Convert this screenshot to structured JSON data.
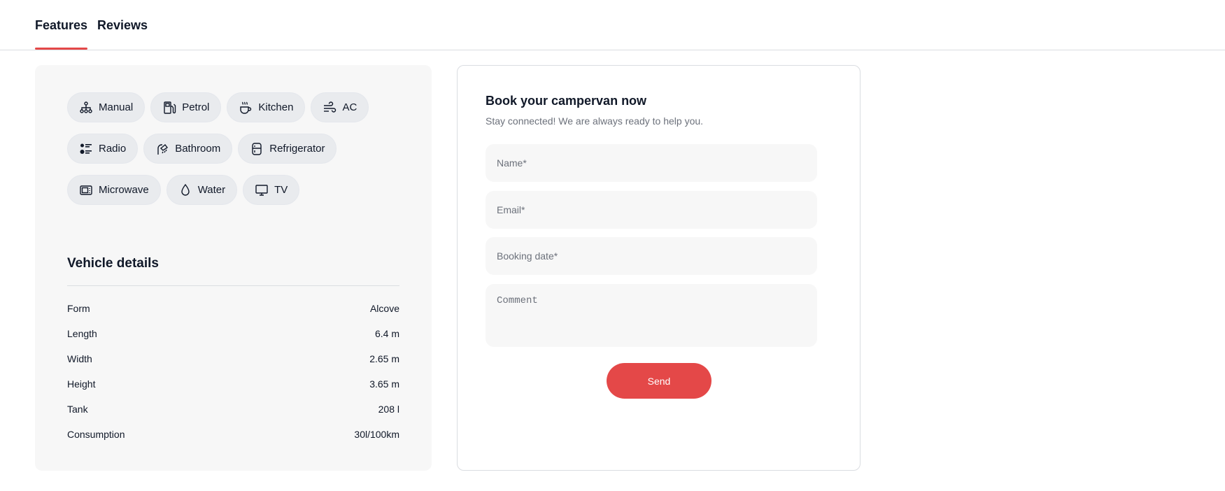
{
  "tabs": [
    {
      "label": "Features",
      "active": true
    },
    {
      "label": "Reviews",
      "active": false
    }
  ],
  "accent_color": "#e44848",
  "features": [
    {
      "label": "Manual",
      "icon": "transmission-icon"
    },
    {
      "label": "Petrol",
      "icon": "fuel-pump-icon"
    },
    {
      "label": "Kitchen",
      "icon": "cup-hot-icon"
    },
    {
      "label": "AC",
      "icon": "wind-icon"
    },
    {
      "label": "Radio",
      "icon": "radio-icon"
    },
    {
      "label": "Bathroom",
      "icon": "shower-icon"
    },
    {
      "label": "Refrigerator",
      "icon": "fridge-icon"
    },
    {
      "label": "Microwave",
      "icon": "microwave-icon"
    },
    {
      "label": "Water",
      "icon": "water-drop-icon"
    },
    {
      "label": "TV",
      "icon": "tv-icon"
    }
  ],
  "vehicle_details": {
    "title": "Vehicle details",
    "rows": [
      {
        "label": "Form",
        "value": "Alcove"
      },
      {
        "label": "Length",
        "value": "6.4 m"
      },
      {
        "label": "Width",
        "value": "2.65 m"
      },
      {
        "label": "Height",
        "value": "3.65 m"
      },
      {
        "label": "Tank",
        "value": "208 l"
      },
      {
        "label": "Consumption",
        "value": "30l/100km"
      }
    ]
  },
  "booking": {
    "title": "Book your campervan now",
    "subtitle": "Stay connected! We are always ready to help you.",
    "name_placeholder": "Name*",
    "email_placeholder": "Email*",
    "date_placeholder": "Booking date*",
    "comment_placeholder": "Comment",
    "send_label": "Send"
  }
}
